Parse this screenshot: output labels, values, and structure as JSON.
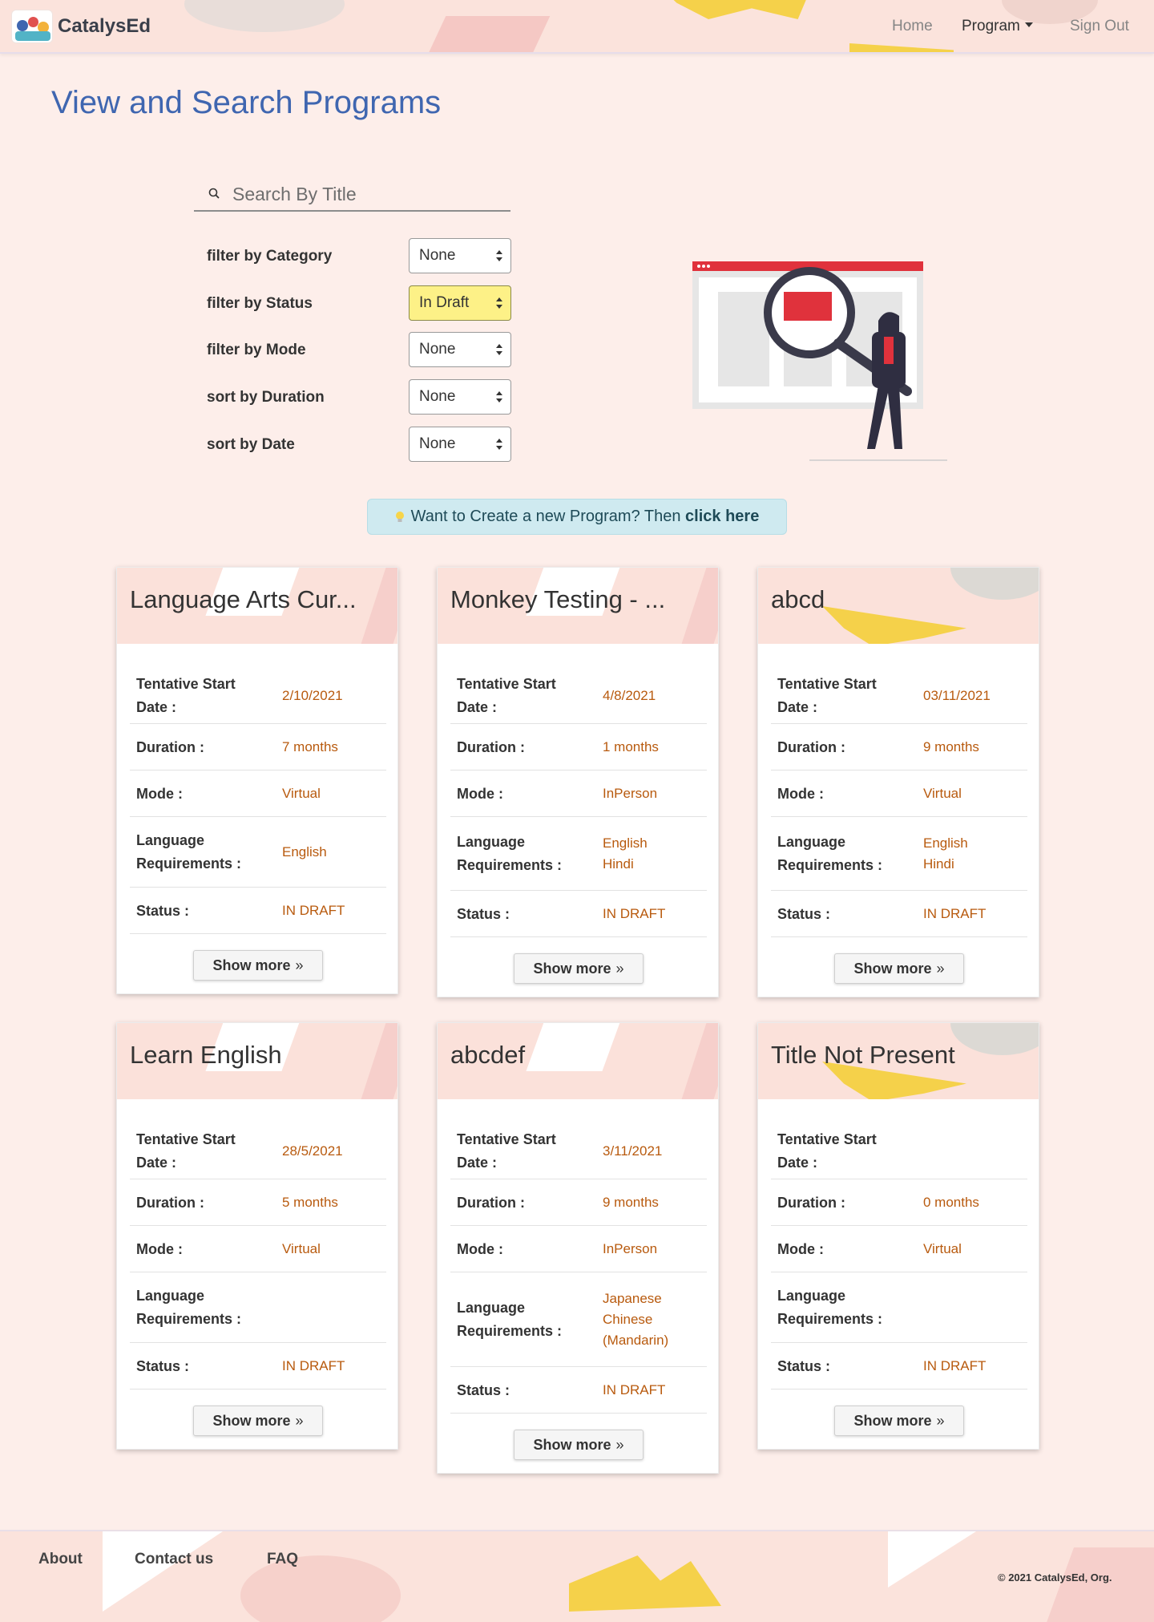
{
  "brand": {
    "name": "CatalysEd"
  },
  "nav": {
    "home": "Home",
    "program": "Program",
    "sign_out": "Sign Out"
  },
  "page": {
    "title": "View and Search Programs"
  },
  "search": {
    "placeholder": "Search By Title",
    "value": ""
  },
  "filters": [
    {
      "label": "filter by Category",
      "value": "None",
      "active": false
    },
    {
      "label": "filter by Status",
      "value": "In Draft",
      "active": true
    },
    {
      "label": "filter by Mode",
      "value": "None",
      "active": false
    },
    {
      "label": "sort by Duration",
      "value": "None",
      "active": false
    },
    {
      "label": "sort by Date",
      "value": "None",
      "active": false
    }
  ],
  "create_banner": {
    "text": "Want to Create a new Program? Then ",
    "link": "click here"
  },
  "field_labels": {
    "start_date_1": "Tentative Start",
    "start_date_2": "Date :",
    "duration": "Duration :",
    "mode": "Mode :",
    "language_1": "Language",
    "language_2": "Requirements :",
    "status": "Status :"
  },
  "show_more_label": "Show more",
  "programs": [
    {
      "title": "Language Arts Cur...",
      "start_date": "2/10/2021",
      "duration": "7 months",
      "mode": "Virtual",
      "languages": [
        "English"
      ],
      "status": "IN DRAFT"
    },
    {
      "title": "Monkey Testing - ...",
      "start_date": "4/8/2021",
      "duration": "1 months",
      "mode": "InPerson",
      "languages": [
        "English",
        "Hindi"
      ],
      "status": "IN DRAFT"
    },
    {
      "title": "abcd",
      "start_date": "03/11/2021",
      "duration": "9 months",
      "mode": "Virtual",
      "languages": [
        "English",
        "Hindi"
      ],
      "status": "IN DRAFT"
    },
    {
      "title": "Learn English",
      "start_date": "28/5/2021",
      "duration": "5 months",
      "mode": "Virtual",
      "languages": [],
      "status": "IN DRAFT"
    },
    {
      "title": "abcdef",
      "start_date": "3/11/2021",
      "duration": "9 months",
      "mode": "InPerson",
      "languages": [
        "Japanese",
        "Chinese",
        "(Mandarin)"
      ],
      "status": "IN DRAFT"
    },
    {
      "title": "Title Not Present",
      "start_date": "",
      "duration": "0 months",
      "mode": "Virtual",
      "languages": [],
      "status": "IN DRAFT"
    }
  ],
  "footer": {
    "about": "About",
    "contact": "Contact us",
    "faq": "FAQ",
    "copyright": "© 2021 CatalysEd, Org."
  },
  "colors": {
    "accent": "#3f66b0",
    "value_text": "#b85a0e",
    "active_filter": "#fdf187",
    "banner": "#cfeaf0"
  }
}
